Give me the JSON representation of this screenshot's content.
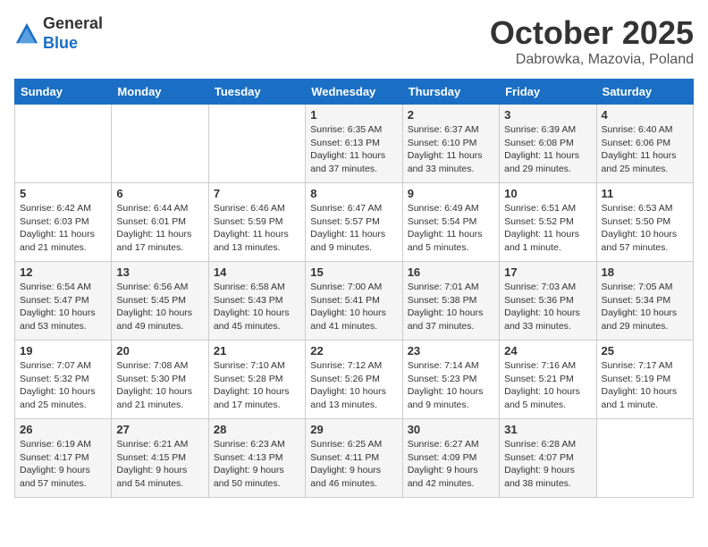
{
  "header": {
    "logo_general": "General",
    "logo_blue": "Blue",
    "month": "October 2025",
    "location": "Dabrowka, Mazovia, Poland"
  },
  "days_of_week": [
    "Sunday",
    "Monday",
    "Tuesday",
    "Wednesday",
    "Thursday",
    "Friday",
    "Saturday"
  ],
  "weeks": [
    [
      {
        "day": "",
        "info": ""
      },
      {
        "day": "",
        "info": ""
      },
      {
        "day": "",
        "info": ""
      },
      {
        "day": "1",
        "info": "Sunrise: 6:35 AM\nSunset: 6:13 PM\nDaylight: 11 hours\nand 37 minutes."
      },
      {
        "day": "2",
        "info": "Sunrise: 6:37 AM\nSunset: 6:10 PM\nDaylight: 11 hours\nand 33 minutes."
      },
      {
        "day": "3",
        "info": "Sunrise: 6:39 AM\nSunset: 6:08 PM\nDaylight: 11 hours\nand 29 minutes."
      },
      {
        "day": "4",
        "info": "Sunrise: 6:40 AM\nSunset: 6:06 PM\nDaylight: 11 hours\nand 25 minutes."
      }
    ],
    [
      {
        "day": "5",
        "info": "Sunrise: 6:42 AM\nSunset: 6:03 PM\nDaylight: 11 hours\nand 21 minutes."
      },
      {
        "day": "6",
        "info": "Sunrise: 6:44 AM\nSunset: 6:01 PM\nDaylight: 11 hours\nand 17 minutes."
      },
      {
        "day": "7",
        "info": "Sunrise: 6:46 AM\nSunset: 5:59 PM\nDaylight: 11 hours\nand 13 minutes."
      },
      {
        "day": "8",
        "info": "Sunrise: 6:47 AM\nSunset: 5:57 PM\nDaylight: 11 hours\nand 9 minutes."
      },
      {
        "day": "9",
        "info": "Sunrise: 6:49 AM\nSunset: 5:54 PM\nDaylight: 11 hours\nand 5 minutes."
      },
      {
        "day": "10",
        "info": "Sunrise: 6:51 AM\nSunset: 5:52 PM\nDaylight: 11 hours\nand 1 minute."
      },
      {
        "day": "11",
        "info": "Sunrise: 6:53 AM\nSunset: 5:50 PM\nDaylight: 10 hours\nand 57 minutes."
      }
    ],
    [
      {
        "day": "12",
        "info": "Sunrise: 6:54 AM\nSunset: 5:47 PM\nDaylight: 10 hours\nand 53 minutes."
      },
      {
        "day": "13",
        "info": "Sunrise: 6:56 AM\nSunset: 5:45 PM\nDaylight: 10 hours\nand 49 minutes."
      },
      {
        "day": "14",
        "info": "Sunrise: 6:58 AM\nSunset: 5:43 PM\nDaylight: 10 hours\nand 45 minutes."
      },
      {
        "day": "15",
        "info": "Sunrise: 7:00 AM\nSunset: 5:41 PM\nDaylight: 10 hours\nand 41 minutes."
      },
      {
        "day": "16",
        "info": "Sunrise: 7:01 AM\nSunset: 5:38 PM\nDaylight: 10 hours\nand 37 minutes."
      },
      {
        "day": "17",
        "info": "Sunrise: 7:03 AM\nSunset: 5:36 PM\nDaylight: 10 hours\nand 33 minutes."
      },
      {
        "day": "18",
        "info": "Sunrise: 7:05 AM\nSunset: 5:34 PM\nDaylight: 10 hours\nand 29 minutes."
      }
    ],
    [
      {
        "day": "19",
        "info": "Sunrise: 7:07 AM\nSunset: 5:32 PM\nDaylight: 10 hours\nand 25 minutes."
      },
      {
        "day": "20",
        "info": "Sunrise: 7:08 AM\nSunset: 5:30 PM\nDaylight: 10 hours\nand 21 minutes."
      },
      {
        "day": "21",
        "info": "Sunrise: 7:10 AM\nSunset: 5:28 PM\nDaylight: 10 hours\nand 17 minutes."
      },
      {
        "day": "22",
        "info": "Sunrise: 7:12 AM\nSunset: 5:26 PM\nDaylight: 10 hours\nand 13 minutes."
      },
      {
        "day": "23",
        "info": "Sunrise: 7:14 AM\nSunset: 5:23 PM\nDaylight: 10 hours\nand 9 minutes."
      },
      {
        "day": "24",
        "info": "Sunrise: 7:16 AM\nSunset: 5:21 PM\nDaylight: 10 hours\nand 5 minutes."
      },
      {
        "day": "25",
        "info": "Sunrise: 7:17 AM\nSunset: 5:19 PM\nDaylight: 10 hours\nand 1 minute."
      }
    ],
    [
      {
        "day": "26",
        "info": "Sunrise: 6:19 AM\nSunset: 4:17 PM\nDaylight: 9 hours\nand 57 minutes."
      },
      {
        "day": "27",
        "info": "Sunrise: 6:21 AM\nSunset: 4:15 PM\nDaylight: 9 hours\nand 54 minutes."
      },
      {
        "day": "28",
        "info": "Sunrise: 6:23 AM\nSunset: 4:13 PM\nDaylight: 9 hours\nand 50 minutes."
      },
      {
        "day": "29",
        "info": "Sunrise: 6:25 AM\nSunset: 4:11 PM\nDaylight: 9 hours\nand 46 minutes."
      },
      {
        "day": "30",
        "info": "Sunrise: 6:27 AM\nSunset: 4:09 PM\nDaylight: 9 hours\nand 42 minutes."
      },
      {
        "day": "31",
        "info": "Sunrise: 6:28 AM\nSunset: 4:07 PM\nDaylight: 9 hours\nand 38 minutes."
      },
      {
        "day": "",
        "info": ""
      }
    ]
  ]
}
